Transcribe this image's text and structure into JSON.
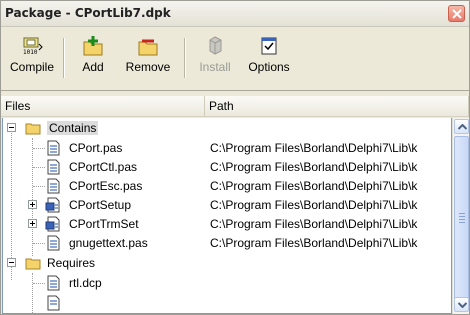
{
  "window": {
    "title": "Package - CPortLib7.dpk"
  },
  "toolbar": {
    "buttons": [
      {
        "label": "Compile",
        "icon": "compile-icon",
        "enabled": true
      },
      {
        "label": "Add",
        "icon": "add-icon",
        "enabled": true
      },
      {
        "label": "Remove",
        "icon": "remove-icon",
        "enabled": true
      },
      {
        "label": "Install",
        "icon": "install-icon",
        "enabled": false
      },
      {
        "label": "Options",
        "icon": "options-icon",
        "enabled": true
      }
    ]
  },
  "columns": {
    "files": "Files",
    "path": "Path"
  },
  "tree": {
    "contains_label": "Contains",
    "requires_label": "Requires",
    "contains_items": [
      {
        "name": "CPort.pas",
        "path": "C:\\Program Files\\Borland\\Delphi7\\Lib\\k"
      },
      {
        "name": "CPortCtl.pas",
        "path": "C:\\Program Files\\Borland\\Delphi7\\Lib\\k"
      },
      {
        "name": "CPortEsc.pas",
        "path": "C:\\Program Files\\Borland\\Delphi7\\Lib\\k"
      },
      {
        "name": "CPortSetup",
        "path": "C:\\Program Files\\Borland\\Delphi7\\Lib\\k"
      },
      {
        "name": "CPortTrmSet",
        "path": "C:\\Program Files\\Borland\\Delphi7\\Lib\\k"
      },
      {
        "name": "gnugettext.pas",
        "path": "C:\\Program Files\\Borland\\Delphi7\\Lib\\k"
      }
    ],
    "requires_items": [
      {
        "name": "rtl.dcp"
      }
    ]
  },
  "colors": {
    "window_bg": "#ece9d8",
    "close_button": "#e8796a",
    "folder": "#f4d46a",
    "selection": "#dcdcdc",
    "scroll_thumb": "#c8d8f6"
  }
}
